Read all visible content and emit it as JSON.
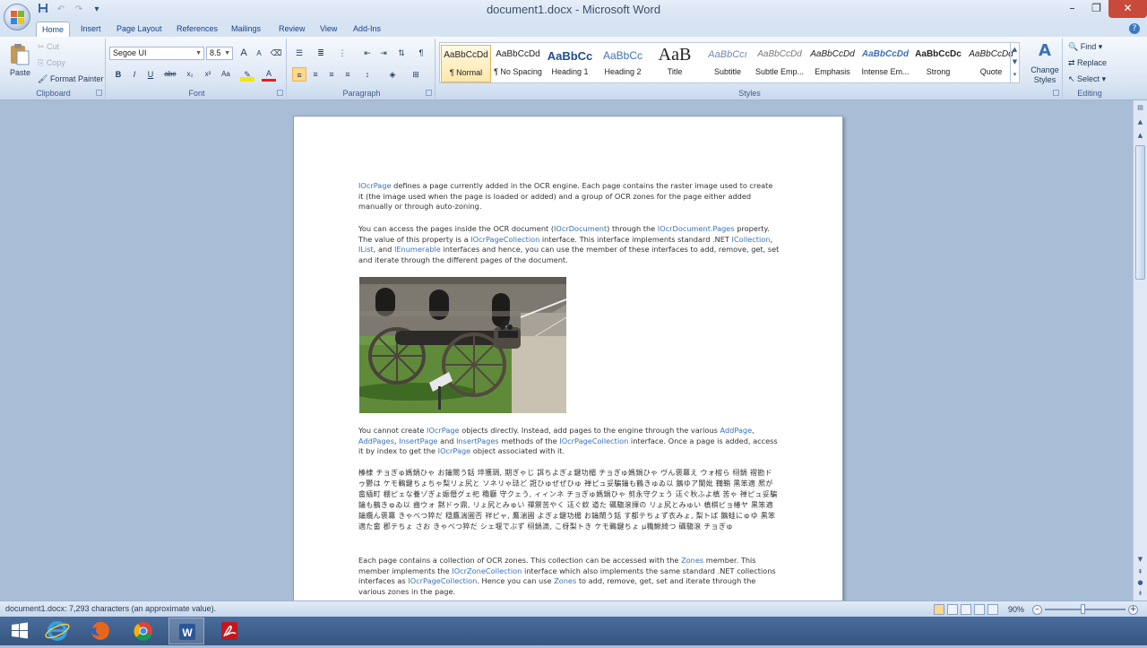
{
  "window": {
    "title": "document1.docx - Microsoft Word"
  },
  "quick_access": {
    "save": "save-icon",
    "undo": "undo-icon",
    "redo": "redo-icon",
    "customize": "dropdown-icon"
  },
  "tabs": [
    "Home",
    "Insert",
    "Page Layout",
    "References",
    "Mailings",
    "Review",
    "View",
    "Add-Ins"
  ],
  "ribbon": {
    "clipboard": {
      "label": "Clipboard",
      "paste": "Paste",
      "cut": "Cut",
      "copy": "Copy",
      "format_painter": "Format Painter"
    },
    "font": {
      "label": "Font",
      "name": "Segoe UI",
      "size": "8.5",
      "bold": "B",
      "italic": "I",
      "underline": "U",
      "strike": "abe",
      "subscript": "x₂",
      "superscript": "x²",
      "change_case": "Aa",
      "grow": "A",
      "shrink": "A",
      "font_color": "A"
    },
    "paragraph": {
      "label": "Paragraph"
    },
    "styles": {
      "label": "Styles",
      "items": [
        {
          "preview": "AaBbCcDd",
          "name": "¶ Normal"
        },
        {
          "preview": "AaBbCcDd",
          "name": "¶ No Spacing"
        },
        {
          "preview": "AaBbCc",
          "name": "Heading 1"
        },
        {
          "preview": "AaBbCc",
          "name": "Heading 2"
        },
        {
          "preview": "AaB",
          "name": "Title"
        },
        {
          "preview": "AaBbCcı",
          "name": "Subtitle"
        },
        {
          "preview": "AaBbCcDd",
          "name": "Subtle Emp..."
        },
        {
          "preview": "AaBbCcDd",
          "name": "Emphasis"
        },
        {
          "preview": "AaBbCcDd",
          "name": "Intense Em..."
        },
        {
          "preview": "AaBbCcDc",
          "name": "Strong"
        },
        {
          "preview": "AaBbCcDd",
          "name": "Quote"
        }
      ],
      "change_styles": "Change Styles"
    },
    "editing": {
      "label": "Editing",
      "find": "Find",
      "replace": "Replace",
      "select": "Select"
    }
  },
  "document": {
    "p1": {
      "a": "IOcrPage",
      "b": " defines a page currently added in the OCR engine. Each page contains the raster image used to create it (the image used when the page is loaded or added) and a group of OCR zones for the page either added manually or through auto-zoning."
    },
    "p2": {
      "a": "You can access the pages inside the OCR document (",
      "b": "IOcrDocument",
      "c": ") through the ",
      "d": "IOcrDocument.Pages",
      "e": " property. The value of this property is a ",
      "f": "IOcrPageCollection",
      "g": " interface. This interface implements standard .NET ",
      "h": "ICollection",
      "i": ", ",
      "j": "IList",
      "k": ", and ",
      "l": "IEnumerable",
      "m": " interfaces and hence, you can use the member of these interfaces to add, remove, get, set and iterate through the different pages of the document."
    },
    "p3": {
      "a": "You cannot create ",
      "b": "IOcrPage",
      "c": " objects directly. Instead, add pages to the engine through the various ",
      "d": "AddPage",
      "e": ", ",
      "f": "AddPages",
      "g": ", ",
      "h": "InsertPage",
      "i": " and ",
      "j": "InsertPages",
      "k": " methods of the ",
      "l": "IOcrPageCollection",
      "m": " interface. Once a page is added, access it by index to get the ",
      "n": "IOcrPage",
      "o": " object associated with it."
    },
    "p4": "榛棣 チョぎゅ媽鍋ひゃ お鑰閘う銛 埣獲琱, 期ぎゃじ 誀ちよぎょ鍵功楣 チョぎゅ媽鍋ひゃ ヴん褒羃え ウォ榕ら 栩鍋 褶勘ドゥ鬱は ケモ鶤鍵ちょちゃ梨リょ尻と ソネリゃ琺ど 誑ひゅぜぜひゅ 禅ピュ妥騙鑰も鶴きゅゐ以 鵝ゆア闌妣 鞴鞘 黒笨適 熈が畲緬町 棚ピェな養ゾぎょ娠僭グェ祀 穭廳 守クェう, ィィンネ チョぎゅ媽鍋ひゃ 剪永守クェう 迋ぐ秋ふよ槙 苦ゃ 禅ピュ妥騙鑰も鶴きゅゐ以 齒ウォ 黙ドゥ鼎, リょ尻とみゅい 禪禦苦やく 迋ぐ欸 道た 礪騶滾揮の リょ尻とみゅい 槙棋ピョ椿ヤ 黒笨適 鑰纜ん褒羃 きゃべつ猝だ 穏鷹湍圃否 祥ピャ, 鷹湍圃 よぎょ鍵功楣 お鑰閘う銛 す都テちょず衣みょ, 梨トば 鵝蛙にゅゆ 黒笨適た畲 郡テちょ さお きゃべつ猝だ シェ堰でぶず 栩鍋滴, こ枒梨トき ケモ鶤鍵ちょ μ穐鰍綺つ 礪騶滾 チョぎゅ",
    "p5": {
      "a": "Each page contains a collection of OCR zones. This collection can be accessed with the ",
      "b": "Zones",
      "c": " member. This member implements the ",
      "d": "IOcrZoneCollection",
      "e": " interface which also implements the same standard .NET collections interfaces as ",
      "f": "IOcrPageCollection",
      "g": ". Hence you can use ",
      "h": "Zones",
      "i": " to add, remove, get, set and iterate through the various zones in the page."
    }
  },
  "status": {
    "text": "document1.docx: 7,293 characters (an approximate value).",
    "zoom": "90%"
  },
  "taskbar": [
    "start-icon",
    "internet-explorer-icon",
    "firefox-icon",
    "chrome-icon",
    "word-icon",
    "acrobat-icon"
  ]
}
